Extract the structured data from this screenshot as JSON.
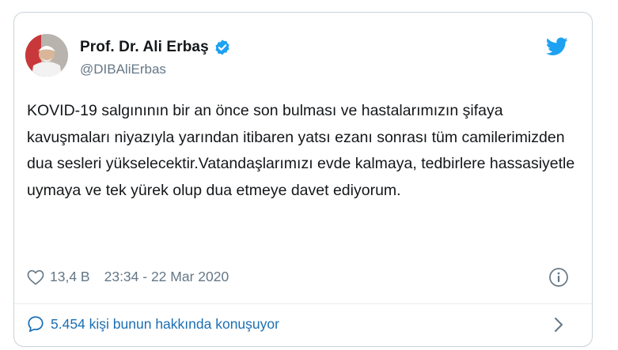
{
  "author": {
    "name": "Prof. Dr. Ali Erbaş",
    "handle": "@DIBAliErbas",
    "verified": true
  },
  "tweet": {
    "text": "KOVID-19 salgınının bir an önce son bulması ve hastalarımızın şifaya kavuşmaları niyazıyla yarından itibaren yatsı ezanı sonrası tüm camilerimizden dua sesleri yükselecektir.Vatandaşlarımızı evde kalmaya, tedbirlere hassasiyetle uymaya ve tek yürek olup dua etmeye davet ediyorum.",
    "likes": "13,4 B",
    "timestamp": "23:34 - 22 Mar 2020"
  },
  "footer": {
    "conversation": "5.454 kişi bunun hakkında konuşuyor"
  },
  "icons": {
    "brand": "twitter-bird-icon",
    "verified": "verified-badge-icon",
    "like": "heart-icon",
    "info": "info-icon",
    "reply": "speech-bubble-icon",
    "expand": "chevron-right-icon"
  },
  "colors": {
    "accent": "#1da1f2",
    "link": "#1b6fb3",
    "secondary_text": "#657786",
    "border": "#c9d3da"
  }
}
